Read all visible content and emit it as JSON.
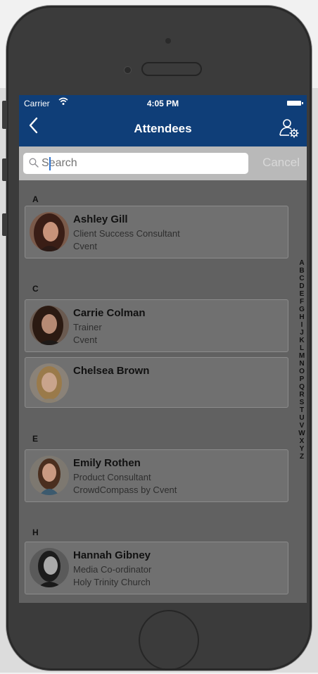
{
  "status": {
    "carrier": "Carrier",
    "wifi_icon": "wifi-icon",
    "time": "4:05 PM",
    "battery_icon": "battery-icon"
  },
  "nav": {
    "back_icon": "chevron-left-icon",
    "title": "Attendees",
    "settings_icon": "user-settings-icon"
  },
  "search": {
    "placeholder": "Search",
    "value": "",
    "cancel_label": "Cancel"
  },
  "sections": [
    {
      "letter": "A",
      "attendees": [
        {
          "name": "Ashley Gill",
          "title": "Client Success Consultant",
          "company": "Cvent"
        }
      ]
    },
    {
      "letter": "C",
      "attendees": [
        {
          "name": "Carrie Colman",
          "title": "Trainer",
          "company": "Cvent"
        },
        {
          "name": "Chelsea Brown",
          "title": "",
          "company": ""
        }
      ]
    },
    {
      "letter": "E",
      "attendees": [
        {
          "name": "Emily Rothen",
          "title": "Product Consultant",
          "company": "CrowdCompass by Cvent"
        }
      ]
    },
    {
      "letter": "H",
      "attendees": [
        {
          "name": "Hannah Gibney",
          "title": "Media Co-ordinator",
          "company": "Holy Trinity Church"
        }
      ]
    }
  ],
  "alphabet_index": [
    "A",
    "B",
    "C",
    "D",
    "E",
    "F",
    "G",
    "H",
    "I",
    "J",
    "K",
    "L",
    "M",
    "N",
    "O",
    "P",
    "Q",
    "R",
    "S",
    "T",
    "U",
    "V",
    "W",
    "X",
    "Y",
    "Z"
  ],
  "colors": {
    "nav_bar": "#0f3e78",
    "overlay": "#616161",
    "card": "#707070"
  }
}
